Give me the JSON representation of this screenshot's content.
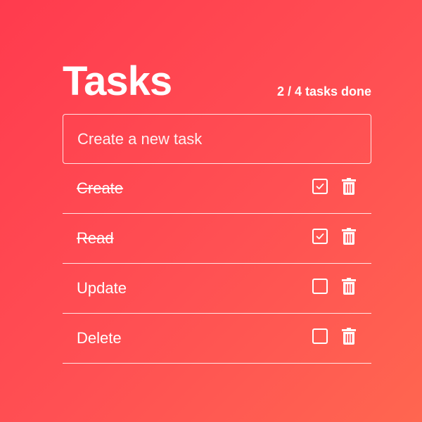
{
  "header": {
    "title": "Tasks",
    "counter": "2 / 4 tasks done"
  },
  "new_task": {
    "placeholder": "Create a new task"
  },
  "tasks": [
    {
      "label": "Create",
      "done": true
    },
    {
      "label": "Read",
      "done": true
    },
    {
      "label": "Update",
      "done": false
    },
    {
      "label": "Delete",
      "done": false
    }
  ],
  "icons": {
    "checkbox": "checkbox-icon",
    "delete": "trash-icon"
  },
  "colors": {
    "gradient_start": "#ff3b4e",
    "gradient_end": "#ff6650",
    "foreground": "#ffffff"
  }
}
